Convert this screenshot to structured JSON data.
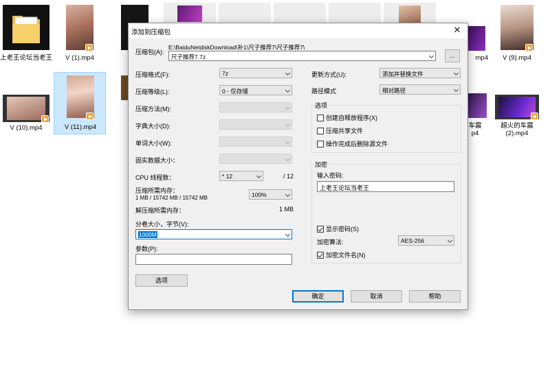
{
  "explorer": {
    "files_row1": [
      {
        "name": "上老王论坛当老王",
        "type": "folder"
      },
      {
        "name": "V (1).mp4",
        "type": "video"
      },
      {
        "name": "",
        "type": "video"
      },
      {
        "name": "",
        "type": "video"
      },
      {
        "name": "",
        "type": "video"
      },
      {
        "name": "",
        "type": "video"
      },
      {
        "name": "",
        "type": "video"
      },
      {
        "name": "",
        "type": "video"
      },
      {
        "name": "mp4",
        "type": "video"
      },
      {
        "name": "V (9).mp4",
        "type": "video"
      }
    ],
    "files_row2": [
      {
        "name": "V (10).mp4",
        "type": "video"
      },
      {
        "name": "V (11).mp4",
        "type": "video"
      },
      {
        "name": "",
        "type": "video"
      },
      {
        "name": "车震",
        "name2": "p4",
        "type": "video"
      },
      {
        "name": "超火的车震",
        "name2": "(2).mp4",
        "type": "video"
      }
    ]
  },
  "dialog": {
    "title": "添加到压缩包",
    "close_icon": "close-icon",
    "archive_label": "压缩包(A):",
    "archive_path": "E:\\BaiduNetdiskDownload\\补1\\尺子推荐7\\尺子推荐7\\",
    "archive_name": "尺子推荐7.7z",
    "browse_label": "...",
    "format_label": "压缩格式(F):",
    "format_value": "7z",
    "level_label": "压缩等级(L):",
    "level_value": "0 - 仅存储",
    "method_label": "压缩方法(M):",
    "dict_label": "字典大小(D):",
    "word_label": "单词大小(W):",
    "solid_label": "固实数据大小：",
    "threads_label": "CPU 线程数：",
    "threads_value": "* 12",
    "threads_total": "/ 12",
    "mem_compress_label": "压缩所需内存：",
    "mem_compress_detail": "1 MB / 15742 MB / 15742 MB",
    "mem_percent": "100%",
    "mem_decompress_label": "解压缩所需内存：",
    "mem_decompress_value": "1 MB",
    "volume_label": "分卷大小，字节(V):",
    "volume_value": "1000M",
    "params_label": "参数(P):",
    "params_value": "",
    "options_button": "选项",
    "update_label": "更新方式(U):",
    "update_value": "添加并替换文件",
    "path_label": "路径模式",
    "path_value": "相对路径",
    "options_group": "选项",
    "opt_sfx": "创建自释放程序(X)",
    "opt_shared": "压缩共享文件",
    "opt_delete": "操作完成后删除源文件",
    "encrypt_group": "加密",
    "password_label": "输入密码:",
    "password_value": "上老王论坛当老王",
    "show_password": "显示密码(S)",
    "encrypt_method_label": "加密算法:",
    "encrypt_method_value": "AES-256",
    "encrypt_names": "加密文件名(N)",
    "ok_button": "确定",
    "cancel_button": "取消",
    "help_button": "帮助"
  }
}
